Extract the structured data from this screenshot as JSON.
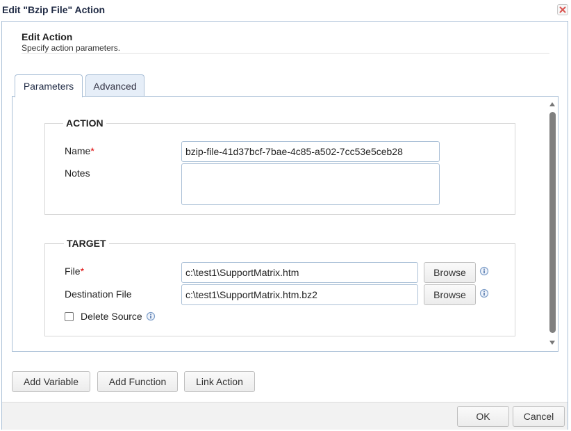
{
  "window": {
    "title": "Edit \"Bzip File\" Action"
  },
  "header": {
    "title": "Edit Action",
    "subtitle": "Specify action parameters."
  },
  "tabs": [
    {
      "label": "Parameters"
    },
    {
      "label": "Advanced"
    }
  ],
  "action_section": {
    "legend": "ACTION",
    "name_label": "Name",
    "name_value": "bzip-file-41d37bcf-7bae-4c85-a502-7cc53e5ceb28",
    "notes_label": "Notes",
    "notes_value": ""
  },
  "target_section": {
    "legend": "TARGET",
    "file_label": "File",
    "file_value": "c:\\test1\\SupportMatrix.htm",
    "dest_label": "Destination File",
    "dest_value": "c:\\test1\\SupportMatrix.htm.bz2",
    "browse_label": "Browse",
    "delete_source_label": "Delete Source",
    "delete_source_checked": false
  },
  "buttons": {
    "add_variable": "Add Variable",
    "add_function": "Add Function",
    "link_action": "Link Action",
    "ok": "OK",
    "cancel": "Cancel"
  },
  "required_marker": "*",
  "colors": {
    "border": "#a9bfd6",
    "required": "#dd0000",
    "title": "#1f2a44",
    "info_icon": "#7f9fc9"
  },
  "icons": {
    "close": "close-icon",
    "info": "info-icon",
    "scroll_up": "arrow-up-icon",
    "scroll_down": "arrow-down-icon"
  }
}
